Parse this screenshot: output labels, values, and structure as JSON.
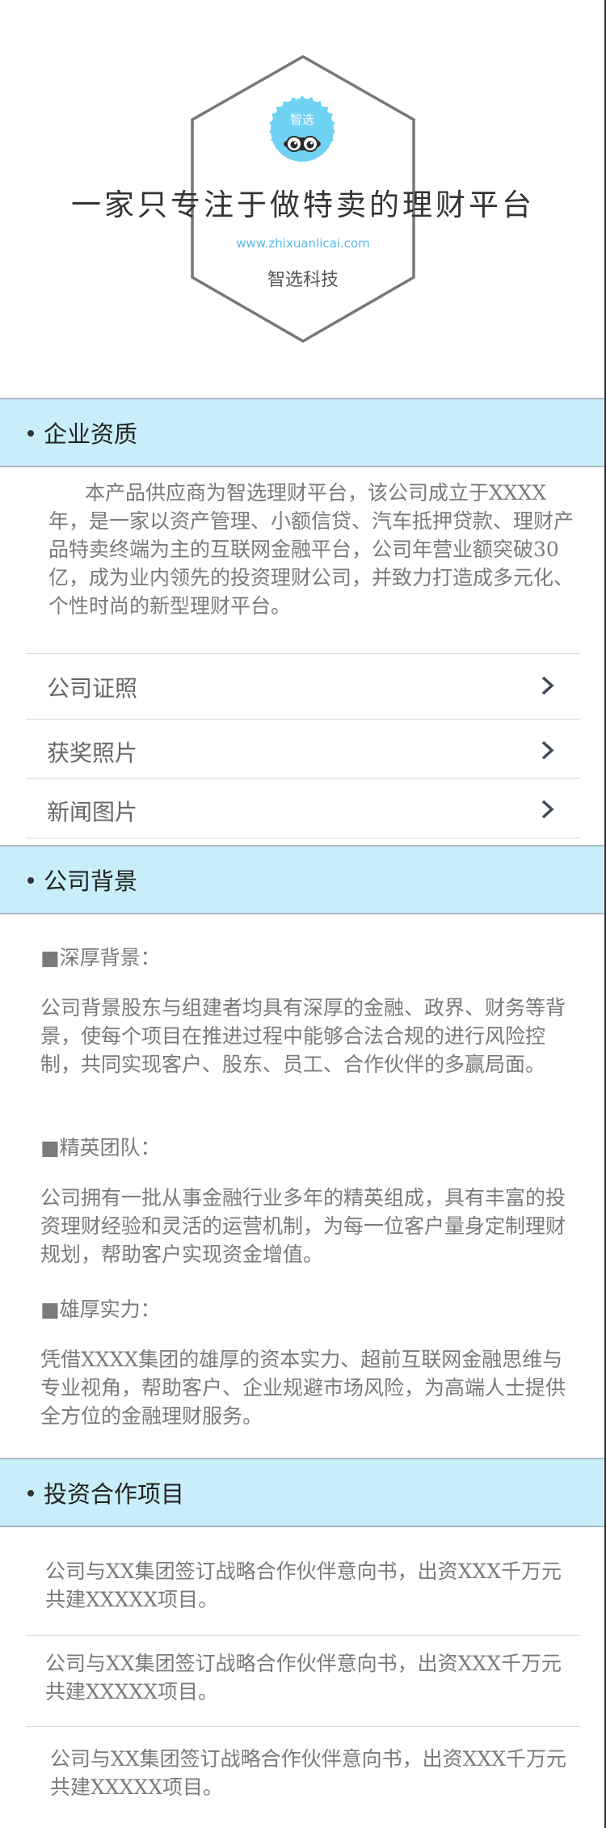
{
  "hero": {
    "logo_text": "智选",
    "slogan": "一家只专注于做特卖的理财平台",
    "url": "www.zhixuanlicai.com",
    "brand": "智选科技"
  },
  "qualification": {
    "title": "企业资质",
    "intro": "本产品供应商为智选理财平台，该公司成立于XXXX年，是一家以资产管理、小额信贷、汽车抵押贷款、理财产品特卖终端为主的互联网金融平台，公司年营业额突破30亿，成为业内领先的投资理财公司，并致力打造成多元化、个性时尚的新型理财平台。",
    "menu": [
      {
        "label": "公司证照"
      },
      {
        "label": "获奖照片"
      },
      {
        "label": "新闻图片"
      }
    ]
  },
  "background": {
    "title": "公司背景",
    "items": [
      {
        "heading": "■深厚背景：",
        "text": "公司背景股东与组建者均具有深厚的金融、政界、财务等背景，使每个项目在推进过程中能够合法合规的进行风险控制，共同实现客户、股东、员工、合作伙伴的多赢局面。"
      },
      {
        "heading": "■精英团队：",
        "text": "公司拥有一批从事金融行业多年的精英组成，具有丰富的投资理财经验和灵活的运营机制，为每一位客户量身定制理财规划，帮助客户实现资金增值。"
      },
      {
        "heading": "■雄厚实力：",
        "text": "凭借XXXX集团的雄厚的资本实力、超前互联网金融思维与专业视角，帮助客户、企业规避市场风险，为高端人士提供全方位的金融理财服务。"
      }
    ]
  },
  "projects": {
    "title": "投资合作项目",
    "items": [
      {
        "text": "公司与XX集团签订战略合作伙伴意向书，出资XXX千万元共建XXXXX项目。"
      },
      {
        "text": "公司与XX集团签订战略合作伙伴意向书，出资XXX千万元共建XXXXX项目。"
      },
      {
        "text": "公司与XX集团签订战略合作伙伴意向书，出资XXX千万元共建XXXXX项目。"
      }
    ]
  },
  "colors": {
    "accent_bar": "#c8eefa",
    "logo": "#6fd2f2",
    "url": "#5ab9e6"
  }
}
